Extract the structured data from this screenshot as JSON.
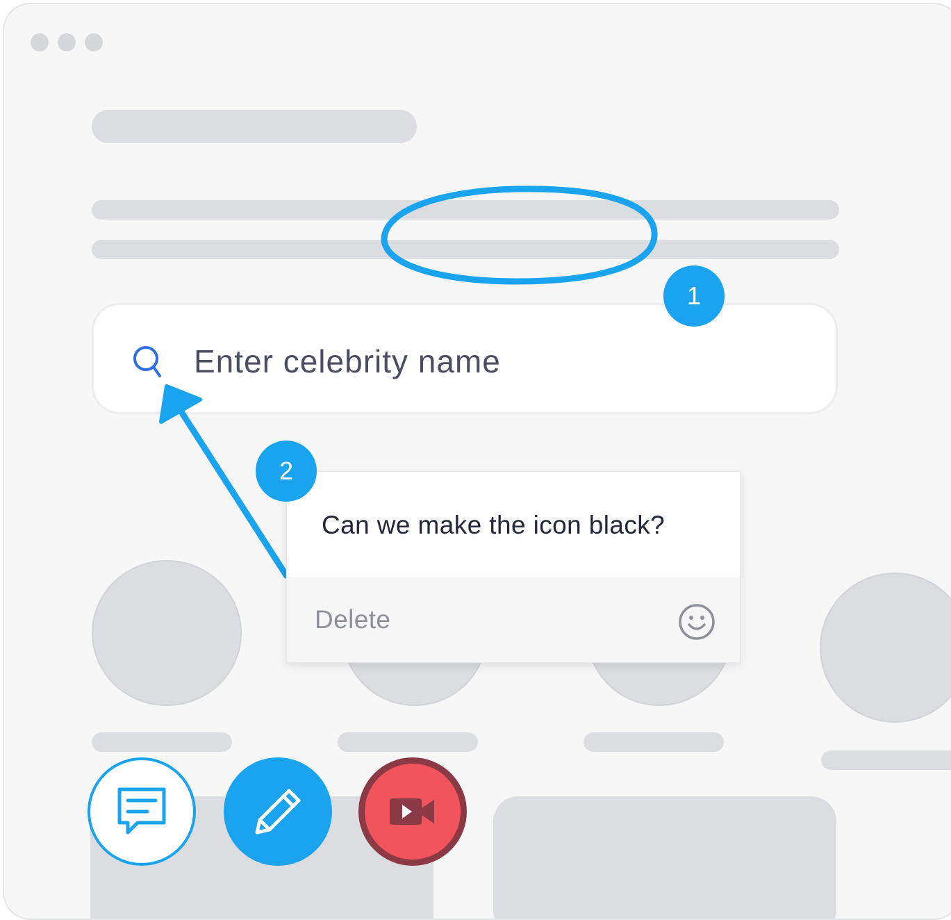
{
  "window": {
    "controls": [
      "window-dot",
      "window-dot",
      "window-dot"
    ]
  },
  "search": {
    "placeholder": "Enter celebrity name",
    "icon": "search-icon",
    "icon_color": "#2f6fe0"
  },
  "annotations": {
    "accent_color": "#1aa3ef",
    "markers": [
      {
        "number": "1",
        "type": "ellipse-highlight"
      },
      {
        "number": "2",
        "type": "arrow-pointer"
      }
    ]
  },
  "comment": {
    "text": "Can we make the icon black?",
    "delete_label": "Delete",
    "emoji_icon": "smiley-icon"
  },
  "toolbar": {
    "buttons": [
      {
        "name": "comment-tool",
        "icon": "message-icon",
        "color": "#1aa3ef"
      },
      {
        "name": "draw-tool",
        "icon": "pencil-icon",
        "color": "#1aa3ef"
      },
      {
        "name": "record-tool",
        "icon": "video-icon",
        "color": "#f2545b"
      }
    ]
  }
}
